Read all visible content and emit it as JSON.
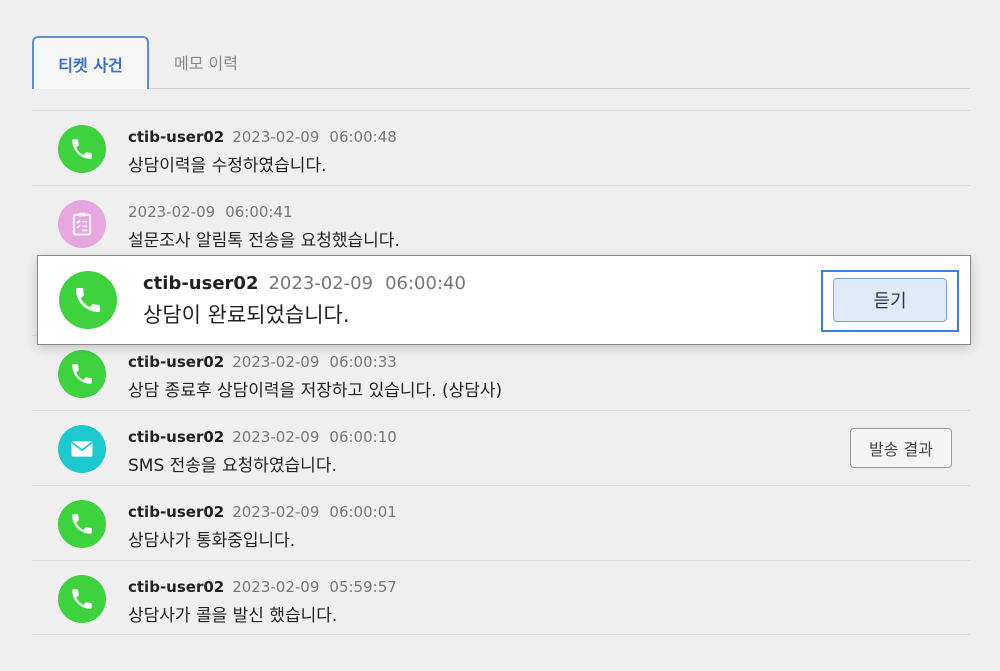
{
  "tabs": [
    {
      "label": "티켓 사건",
      "active": true
    },
    {
      "label": "메모 이력",
      "active": false
    }
  ],
  "highlighted": {
    "user": "ctib-user02",
    "date": "2023-02-09",
    "time": "06:00:40",
    "message": "상담이 완료되었습니다.",
    "icon": "phone-icon",
    "button_label": "듣기"
  },
  "items": [
    {
      "user": "ctib-user02",
      "date": "2023-02-09",
      "time": "06:00:48",
      "message": "상담이력을 수정하였습니다.",
      "icon": "phone-icon"
    },
    {
      "user": "",
      "date": "2023-02-09",
      "time": "06:00:41",
      "message": "설문조사 알림톡 전송을 요청했습니다.",
      "icon": "clipboard-icon"
    },
    {
      "user": "ctib-user02",
      "date": "2023-02-09",
      "time": "06:00:33",
      "message": "상담 종료후 상담이력을 저장하고 있습니다. (상담사)",
      "icon": "phone-icon"
    },
    {
      "user": "ctib-user02",
      "date": "2023-02-09",
      "time": "06:00:10",
      "message": "SMS 전송을 요청하였습니다.",
      "icon": "mail-icon",
      "button_label": "발송 결과"
    },
    {
      "user": "ctib-user02",
      "date": "2023-02-09",
      "time": "06:00:01",
      "message": "상담사가 통화중입니다.",
      "icon": "phone-icon"
    },
    {
      "user": "ctib-user02",
      "date": "2023-02-09",
      "time": "05:59:57",
      "message": "상담사가 콜을 발신 했습니다.",
      "icon": "phone-icon"
    }
  ],
  "colors": {
    "accent": "#3a6fc4",
    "phone": "#3fd23f",
    "survey": "#e6a6e0",
    "sms": "#1ec8cf"
  }
}
